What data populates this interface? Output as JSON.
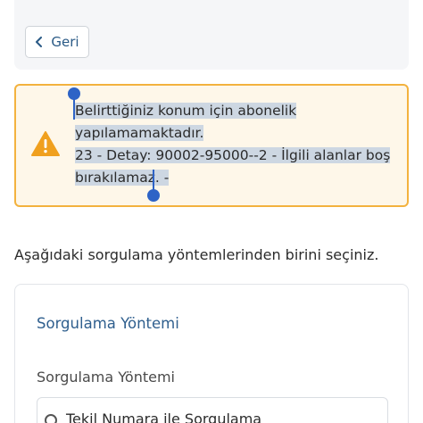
{
  "nav": {
    "back_label": "Geri"
  },
  "alert": {
    "line1": "Belirttiğiniz konum için abonelik",
    "line2": "yapılamamaktadır.",
    "line3": "23 - Detay: 90002-95000--2 - İlgili alanlar boş",
    "line4": "bırakılamaz. -",
    "colors": {
      "border": "#f3b23e",
      "background": "#fef7e9",
      "icon": "#f0a01e",
      "selection": "#cdd7e2",
      "cursor": "#2e63c6"
    },
    "icon": "warning-triangle-icon"
  },
  "instruction": "Aşağıdaki sorgulama yöntemlerinden birini seçiniz.",
  "method": {
    "title": "Sorgulama Yöntemi",
    "label": "Sorgulama Yöntemi",
    "options": [
      {
        "label": "Tekil Numara ile Sorgulama"
      }
    ]
  }
}
